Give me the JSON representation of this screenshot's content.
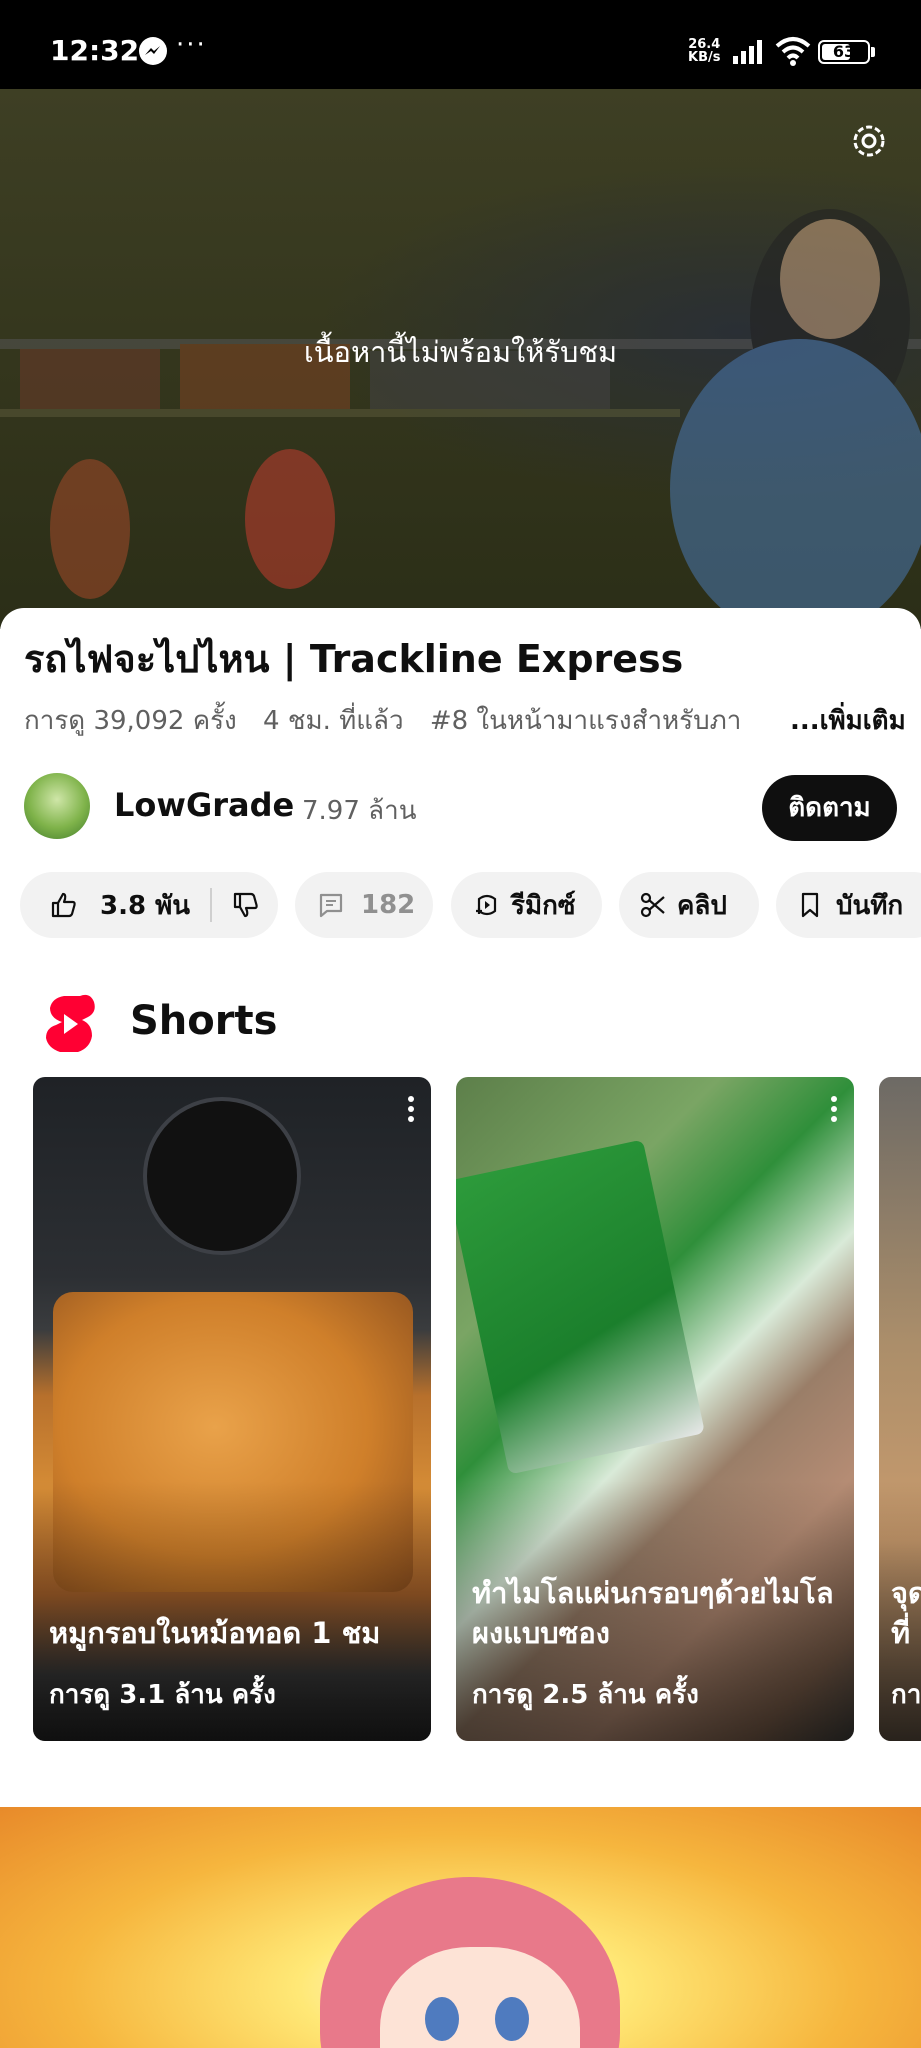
{
  "status_bar": {
    "time": "12:32",
    "dots": "···",
    "net_speed_value": "26.4",
    "net_speed_unit": "KB/s",
    "battery": "63",
    "battery_level": 0.63
  },
  "player": {
    "unavailable_text": "เนื้อหานี้ไม่พร้อมให้รับชม",
    "settings_icon": "gear-icon"
  },
  "video": {
    "title": "รถไฟจะไปไหน | Trackline Express",
    "views": "การดู 39,092 ครั้ง",
    "time_ago": "4 ชม. ที่แล้ว",
    "trending": "#8 ในหน้ามาแรงสำหรับภา",
    "more_label": "...เพิ่มเติม"
  },
  "channel": {
    "name": "LowGrade",
    "subscribers": "7.97 ล้าน",
    "subscribe_label": "ติดตาม"
  },
  "actions": {
    "likes": "3.8 พัน",
    "comments": "182",
    "remix": "รีมิกซ์",
    "clip": "คลิป",
    "save": "บันทึก"
  },
  "shorts": {
    "heading": "Shorts",
    "items": [
      {
        "title": "หมูกรอบในหม้อทอด 1 ชม",
        "views": "การดู 3.1 ล้าน ครั้ง"
      },
      {
        "title": "ทำไมโลแผ่นกรอบๆด้วยไมโลผงแบบซอง",
        "views": "การดู 2.5 ล้าน ครั้ง"
      },
      {
        "title": "จุด ที่",
        "views": "กา"
      }
    ]
  },
  "colors": {
    "accent_red": "#ff0033",
    "primary_text": "#0f0f0f",
    "secondary_text": "#606060",
    "pill_bg": "#f2f2f2"
  }
}
